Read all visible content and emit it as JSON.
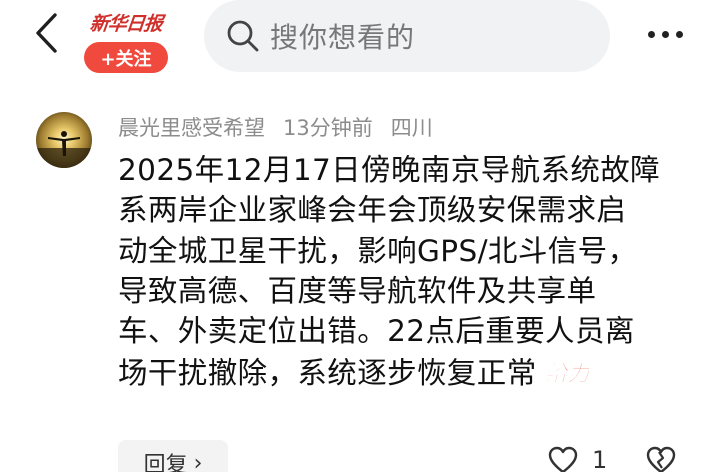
{
  "header": {
    "logo_text": "新华日报",
    "follow_label": "+关注",
    "search_placeholder": "搜你想看的",
    "icons": [
      "back-arrow-icon",
      "search-icon",
      "more-dots-icon"
    ]
  },
  "comment": {
    "user_name": "晨光里感受希望",
    "time_ago": "13分钟前",
    "location": "四川",
    "text_lines": [
      "2025年12月17日傍晚南京导航系统故障",
      "系两岸企业家峰会年会顶级安保需求启",
      "动全城卫星干扰，影响GPS/北斗信号，",
      "导致高德、百度等导航软件及共享单",
      "车、外卖定位出错。22点后重要人员离",
      "场干扰撤除，系统逐步恢复正常"
    ],
    "sticker_text": "给力",
    "reply_label": "回复",
    "like_count": "1",
    "colors": {
      "brand_red": "#f04a3e",
      "meta_gray": "#8c8c8c",
      "search_bg": "#f1f2f4"
    },
    "icons": [
      "avatar",
      "heart-outline-icon",
      "dislike-heart-icon",
      "chevron-right-icon"
    ]
  }
}
